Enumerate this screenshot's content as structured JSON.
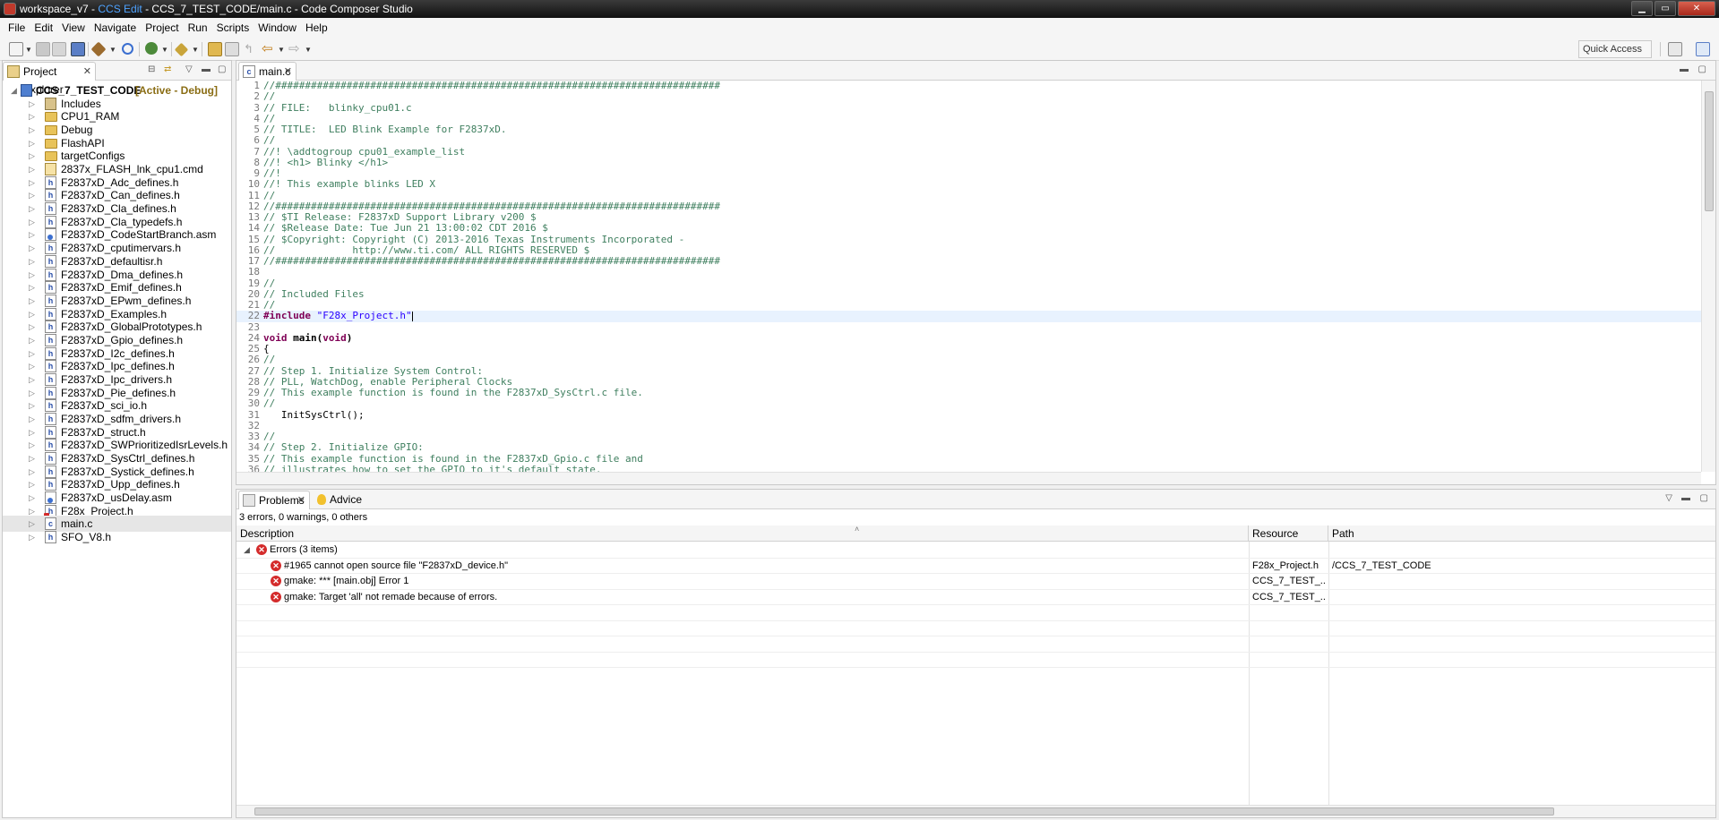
{
  "window": {
    "title_prefix": "workspace_v7 - ",
    "perspective": "CCS Edit",
    "title_suffix": " - CCS_7_TEST_CODE/main.c - Code Composer Studio",
    "minimize": "▁",
    "maximize": "▭",
    "close": "✕"
  },
  "menu": [
    "File",
    "Edit",
    "View",
    "Navigate",
    "Project",
    "Run",
    "Scripts",
    "Window",
    "Help"
  ],
  "toolbar": {
    "quick_access": "Quick Access"
  },
  "explorer": {
    "tab_label": "Project Explorer",
    "project_name": "CCS_7_TEST_CODE",
    "project_status": "[Active - Debug]",
    "items": [
      {
        "label": "Includes",
        "kind": "inc"
      },
      {
        "label": "CPU1_RAM",
        "kind": "folder"
      },
      {
        "label": "Debug",
        "kind": "folder"
      },
      {
        "label": "FlashAPI",
        "kind": "folder"
      },
      {
        "label": "targetConfigs",
        "kind": "folder"
      },
      {
        "label": "2837x_FLASH_lnk_cpu1.cmd",
        "kind": "cmd"
      },
      {
        "label": "F2837xD_Adc_defines.h",
        "kind": "h"
      },
      {
        "label": "F2837xD_Can_defines.h",
        "kind": "h"
      },
      {
        "label": "F2837xD_Cla_defines.h",
        "kind": "h"
      },
      {
        "label": "F2837xD_Cla_typedefs.h",
        "kind": "h"
      },
      {
        "label": "F2837xD_CodeStartBranch.asm",
        "kind": "asm"
      },
      {
        "label": "F2837xD_cputimervars.h",
        "kind": "h"
      },
      {
        "label": "F2837xD_defaultisr.h",
        "kind": "h"
      },
      {
        "label": "F2837xD_Dma_defines.h",
        "kind": "h"
      },
      {
        "label": "F2837xD_Emif_defines.h",
        "kind": "h"
      },
      {
        "label": "F2837xD_EPwm_defines.h",
        "kind": "h"
      },
      {
        "label": "F2837xD_Examples.h",
        "kind": "h"
      },
      {
        "label": "F2837xD_GlobalPrototypes.h",
        "kind": "h"
      },
      {
        "label": "F2837xD_Gpio_defines.h",
        "kind": "h"
      },
      {
        "label": "F2837xD_I2c_defines.h",
        "kind": "h"
      },
      {
        "label": "F2837xD_Ipc_defines.h",
        "kind": "h"
      },
      {
        "label": "F2837xD_Ipc_drivers.h",
        "kind": "h"
      },
      {
        "label": "F2837xD_Pie_defines.h",
        "kind": "h"
      },
      {
        "label": "F2837xD_sci_io.h",
        "kind": "h"
      },
      {
        "label": "F2837xD_sdfm_drivers.h",
        "kind": "h"
      },
      {
        "label": "F2837xD_struct.h",
        "kind": "h"
      },
      {
        "label": "F2837xD_SWPrioritizedIsrLevels.h",
        "kind": "h"
      },
      {
        "label": "F2837xD_SysCtrl_defines.h",
        "kind": "h"
      },
      {
        "label": "F2837xD_Systick_defines.h",
        "kind": "h"
      },
      {
        "label": "F2837xD_Upp_defines.h",
        "kind": "h"
      },
      {
        "label": "F2837xD_usDelay.asm",
        "kind": "asm"
      },
      {
        "label": "F28x_Project.h",
        "kind": "herr"
      },
      {
        "label": "main.c",
        "kind": "c",
        "selected": true
      },
      {
        "label": "SFO_V8.h",
        "kind": "h"
      }
    ]
  },
  "editor": {
    "tab_label": "main.c",
    "current_line": 22,
    "lines": [
      {
        "n": "1",
        "t": "//###########################################################################",
        "s": "comment"
      },
      {
        "n": "2",
        "t": "//",
        "s": "comment"
      },
      {
        "n": "3",
        "t": "// FILE:   blinky_cpu01.c",
        "s": "comment"
      },
      {
        "n": "4",
        "t": "//",
        "s": "comment"
      },
      {
        "n": "5",
        "t": "// TITLE:  LED Blink Example for F2837xD.",
        "s": "comment"
      },
      {
        "n": "6",
        "t": "//",
        "s": "comment"
      },
      {
        "n": "7",
        "t": "//! \\addtogroup cpu01_example_list",
        "s": "comment"
      },
      {
        "n": "8",
        "t": "//! <h1> Blinky </h1>",
        "s": "comment"
      },
      {
        "n": "9",
        "t": "//!",
        "s": "comment"
      },
      {
        "n": "10",
        "t": "//! This example blinks LED X",
        "s": "comment"
      },
      {
        "n": "11",
        "t": "//",
        "s": "comment"
      },
      {
        "n": "12",
        "t": "//###########################################################################",
        "s": "comment"
      },
      {
        "n": "13",
        "t": "// $TI Release: F2837xD Support Library v200 $",
        "s": "comment"
      },
      {
        "n": "14",
        "t": "// $Release Date: Tue Jun 21 13:00:02 CDT 2016 $",
        "s": "comment"
      },
      {
        "n": "15",
        "t": "// $Copyright: Copyright (C) 2013-2016 Texas Instruments Incorporated -",
        "s": "comment"
      },
      {
        "n": "16",
        "t": "//             http://www.ti.com/ ALL RIGHTS RESERVED $",
        "s": "comment"
      },
      {
        "n": "17",
        "t": "//###########################################################################",
        "s": "comment"
      },
      {
        "n": "18",
        "t": "",
        "s": "plain"
      },
      {
        "n": "19",
        "t": "//",
        "s": "comment"
      },
      {
        "n": "20",
        "t": "// Included Files",
        "s": "comment"
      },
      {
        "n": "21",
        "t": "//",
        "s": "comment"
      },
      {
        "n": "22",
        "pre": "#include ",
        "str": "\"F28x_Project.h\"",
        "s": "include"
      },
      {
        "n": "23",
        "t": "",
        "s": "plain"
      },
      {
        "n": "24",
        "kw": "void ",
        "t": "main(",
        "kw2": "void",
        "t2": ")",
        "s": "decl"
      },
      {
        "n": "25",
        "t": "{",
        "s": "plain"
      },
      {
        "n": "26",
        "t": "//",
        "s": "comment"
      },
      {
        "n": "27",
        "t": "// Step 1. Initialize System Control:",
        "s": "comment"
      },
      {
        "n": "28",
        "t": "// PLL, WatchDog, enable Peripheral Clocks",
        "s": "comment"
      },
      {
        "n": "29",
        "t": "// This example function is found in the F2837xD_SysCtrl.c file.",
        "s": "comment"
      },
      {
        "n": "30",
        "t": "//",
        "s": "comment"
      },
      {
        "n": "31",
        "t": "   InitSysCtrl();",
        "s": "plain"
      },
      {
        "n": "32",
        "t": "",
        "s": "plain"
      },
      {
        "n": "33",
        "t": "//",
        "s": "comment"
      },
      {
        "n": "34",
        "t": "// Step 2. Initialize GPIO:",
        "s": "comment"
      },
      {
        "n": "35",
        "t": "// This example function is found in the F2837xD_Gpio.c file and",
        "s": "comment"
      },
      {
        "n": "36",
        "t": "// illustrates how to set the GPIO to it's default state.",
        "s": "comment"
      }
    ]
  },
  "problems": {
    "tab_label": "Problems",
    "advice_label": "Advice",
    "summary": "3 errors, 0 warnings, 0 others",
    "columns": {
      "description": "Description",
      "resource": "Resource",
      "path": "Path"
    },
    "group_label": "Errors (3 items)",
    "rows": [
      {
        "description": "#1965 cannot open source file \"F2837xD_device.h\"",
        "resource": "F28x_Project.h",
        "path": "/CCS_7_TEST_CODE"
      },
      {
        "description": "gmake: *** [main.obj] Error 1",
        "resource": "CCS_7_TEST_...",
        "path": ""
      },
      {
        "description": "gmake: Target 'all' not remade because of errors.",
        "resource": "CCS_7_TEST_...",
        "path": ""
      }
    ]
  }
}
